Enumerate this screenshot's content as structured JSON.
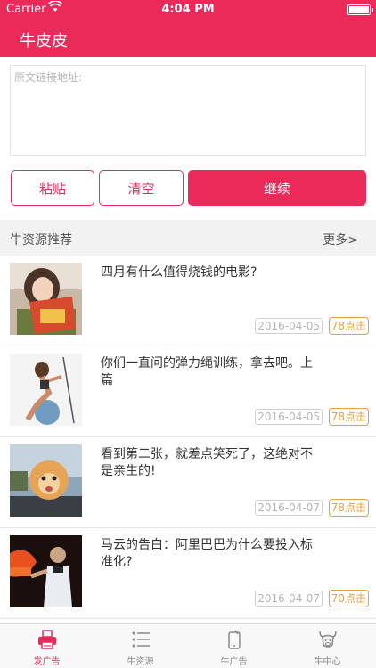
{
  "status_bar": {
    "carrier": "Carrier",
    "time": "4:04 PM"
  },
  "header": {
    "title": "牛皮皮"
  },
  "input": {
    "placeholder": "原文链接地址:",
    "value": ""
  },
  "buttons": {
    "paste": "粘贴",
    "clear": "清空",
    "continue": "继续"
  },
  "section": {
    "title": "牛资源推荐",
    "more": "更多>"
  },
  "articles": [
    {
      "title": "四月有什么值得烧钱的电影?",
      "date": "2016-04-05",
      "clicks": "78点击",
      "thumb": "woman-reading-icon"
    },
    {
      "title": "你们一直问的弹力绳训练，拿去吧。上篇",
      "date": "2016-04-05",
      "clicks": "78点击",
      "thumb": "fitness-woman-icon"
    },
    {
      "title": "看到第二张，就差点笑死了，这绝对不是亲生的!",
      "date": "2016-04-07",
      "clicks": "78点击",
      "thumb": "pomeranian-dog-icon"
    },
    {
      "title": "马云的告白：阿里巴巴为什么要投入标准化?",
      "date": "2016-04-07",
      "clicks": "70点击",
      "thumb": "speaker-stage-icon"
    }
  ],
  "tabs": [
    {
      "label": "发广告",
      "icon": "printer-icon",
      "active": true
    },
    {
      "label": "牛资源",
      "icon": "list-icon",
      "active": false
    },
    {
      "label": "牛广告",
      "icon": "phone-icon",
      "active": false
    },
    {
      "label": "牛中心",
      "icon": "bull-head-icon",
      "active": false
    }
  ],
  "colors": {
    "brand": "#eb2a5a",
    "accent_orange": "#e9a040",
    "section_bg": "#f2f2f2"
  }
}
